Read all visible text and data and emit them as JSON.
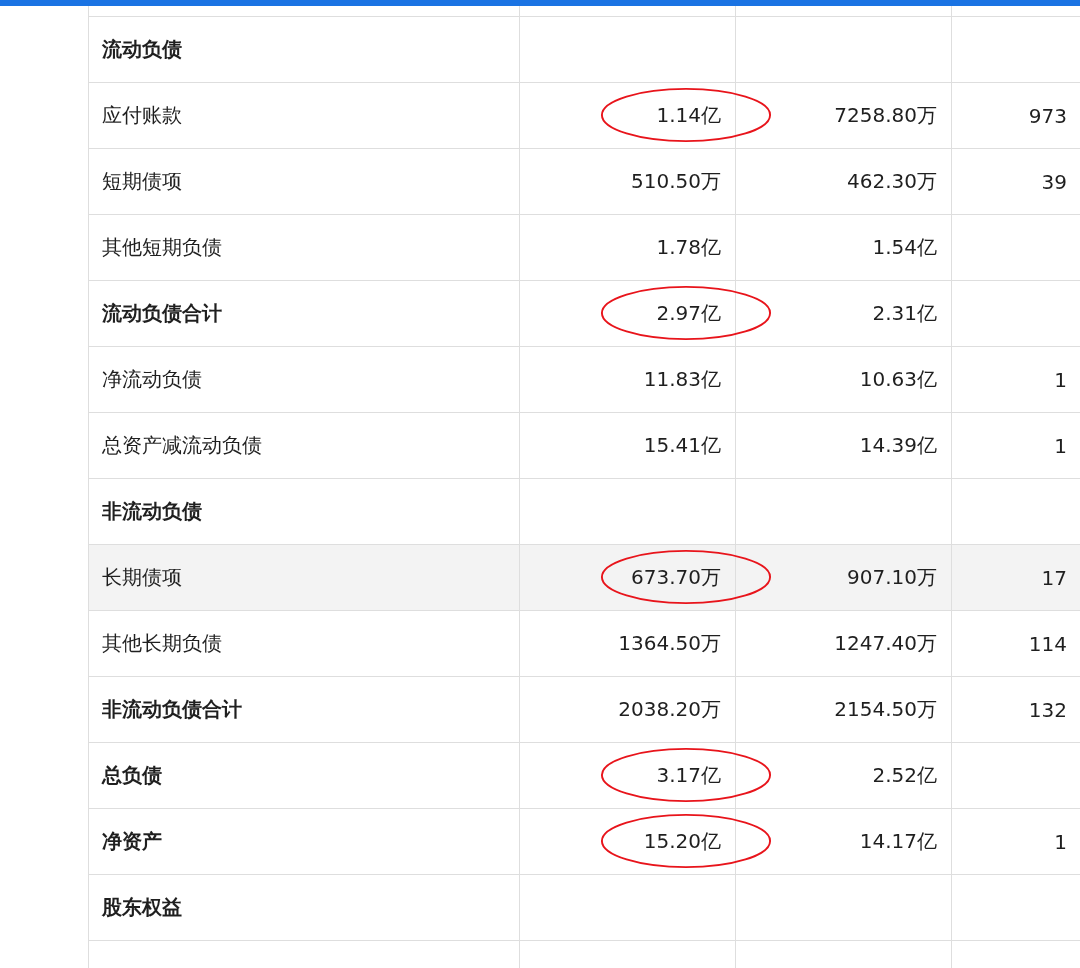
{
  "table": {
    "rows": [
      {
        "kind": "section",
        "label": "流动负债",
        "highlighted": false,
        "circled": false
      },
      {
        "kind": "item",
        "label": "应付账款",
        "column_2": "1.14亿",
        "column_3": "7258.80万",
        "column_4": "973",
        "highlighted": false,
        "circled": true
      },
      {
        "kind": "item",
        "label": "短期债项",
        "column_2": "510.50万",
        "column_3": "462.30万",
        "column_4": "39",
        "highlighted": false,
        "circled": false
      },
      {
        "kind": "item",
        "label": "其他短期负债",
        "column_2": "1.78亿",
        "column_3": "1.54亿",
        "highlighted": false,
        "circled": false
      },
      {
        "kind": "total",
        "label": "流动负债合计",
        "column_2": "2.97亿",
        "column_3": "2.31亿",
        "highlighted": false,
        "circled": true
      },
      {
        "kind": "item",
        "label": "净流动负债",
        "column_2": "11.83亿",
        "column_3": "10.63亿",
        "column_4": "1",
        "highlighted": false,
        "circled": false
      },
      {
        "kind": "item",
        "label": "总资产减流动负债",
        "column_2": "15.41亿",
        "column_3": "14.39亿",
        "column_4": "1",
        "highlighted": false,
        "circled": false
      },
      {
        "kind": "section",
        "label": "非流动负债",
        "highlighted": false,
        "circled": false
      },
      {
        "kind": "item",
        "label": "长期债项",
        "column_2": "673.70万",
        "column_3": "907.10万",
        "column_4": "17",
        "highlighted": true,
        "circled": true
      },
      {
        "kind": "item",
        "label": "其他长期负债",
        "column_2": "1364.50万",
        "column_3": "1247.40万",
        "column_4": "114",
        "highlighted": false,
        "circled": false
      },
      {
        "kind": "total",
        "label": "非流动负债合计",
        "column_2": "2038.20万",
        "column_3": "2154.50万",
        "column_4": "132",
        "highlighted": false,
        "circled": false
      },
      {
        "kind": "total",
        "label": "总负债",
        "column_2": "3.17亿",
        "column_3": "2.52亿",
        "highlighted": false,
        "circled": true
      },
      {
        "kind": "total",
        "label": "净资产",
        "column_2": "15.20亿",
        "column_3": "14.17亿",
        "column_4": "1",
        "highlighted": false,
        "circled": true
      },
      {
        "kind": "section",
        "label": "股东权益",
        "highlighted": false,
        "circled": false
      }
    ]
  }
}
